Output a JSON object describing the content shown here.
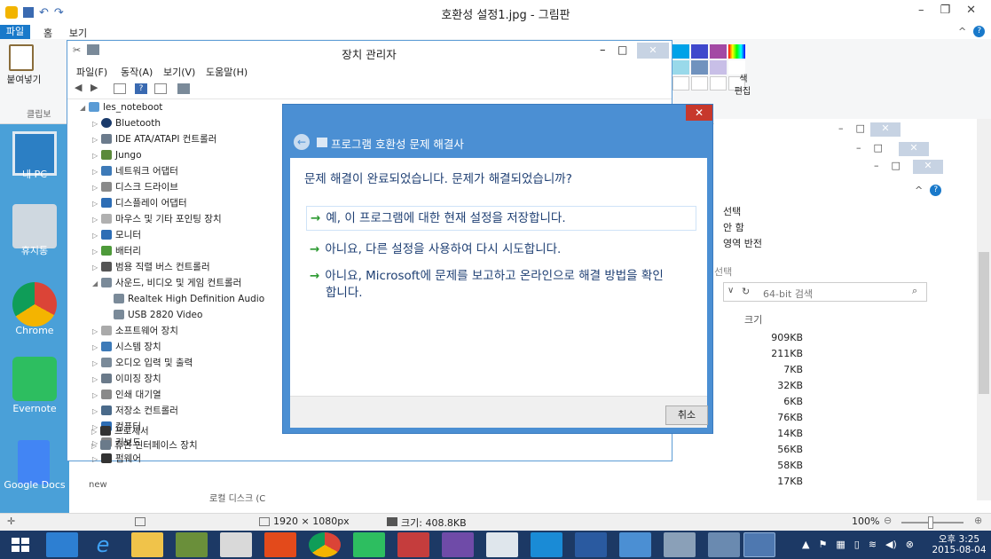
{
  "paint": {
    "title": "호환성 설정1.jpg - 그림판",
    "tabs": [
      "파일",
      "홈",
      "보기"
    ],
    "paste_label": "붙여넣기",
    "clipboard_label": "클립보",
    "color_edit_label1": "색",
    "color_edit_label2": "편집",
    "select_items": [
      "선택",
      "안 함",
      "영역 반전"
    ],
    "select_label": "선택",
    "search_placeholder": "64-bit 검색",
    "size_header": "크기",
    "file_sizes": [
      "909KB",
      "211KB",
      "7KB",
      "32KB",
      "6KB",
      "76KB",
      "14KB",
      "56KB",
      "58KB",
      "17KB"
    ],
    "status": {
      "dimensions": "1920 × 1080px",
      "size": "크기: 408.8KB",
      "zoom": "100%"
    }
  },
  "desktop": {
    "icons": [
      "내 PC",
      "휴지통",
      "Chrome",
      "Evernote",
      "Google Docs"
    ],
    "partial": [
      "new",
      "로컬 디스크 (C"
    ]
  },
  "device_manager": {
    "title": "장치 관리자",
    "menu": [
      "파일(F)",
      "동작(A)",
      "보기(V)",
      "도움말(H)"
    ],
    "root": "les_noteboot",
    "tree": [
      "Bluetooth",
      "IDE ATA/ATAPI 컨트롤러",
      "Jungo",
      "네트워크 어댑터",
      "디스크 드라이브",
      "디스플레이 어댑터",
      "마우스 및 기타 포인팅 장치",
      "모니터",
      "배터리",
      "범용 직렬 버스 컨트롤러",
      "사운드, 비디오 및 게임 컨트롤러",
      "Realtek High Definition Audio",
      "USB 2820 Video",
      "소프트웨어 장치",
      "시스템 장치",
      "오디오 입력 및 출력",
      "이미징 장치",
      "인쇄 대기열",
      "저장소 컨트롤러",
      "컴퓨터",
      "키보드",
      "펌웨어",
      "프로세서",
      "휴먼 인터페이스 장치"
    ]
  },
  "wizard": {
    "title": "프로그램 호환성 문제 해결사",
    "question": "문제 해결이 완료되었습니다. 문제가 해결되었습니까?",
    "option1": "예, 이 프로그램에 대한 현재 설정을 저장합니다.",
    "option2": "아니요, 다른 설정을 사용하여 다시 시도합니다.",
    "option3_line1": "아니요, Microsoft에 문제를 보고하고 온라인으로 해결 방법을 확인",
    "option3_line2": "합니다.",
    "cancel": "취소"
  },
  "clock": {
    "time": "오후 3:25",
    "date": "2015-08-04"
  }
}
